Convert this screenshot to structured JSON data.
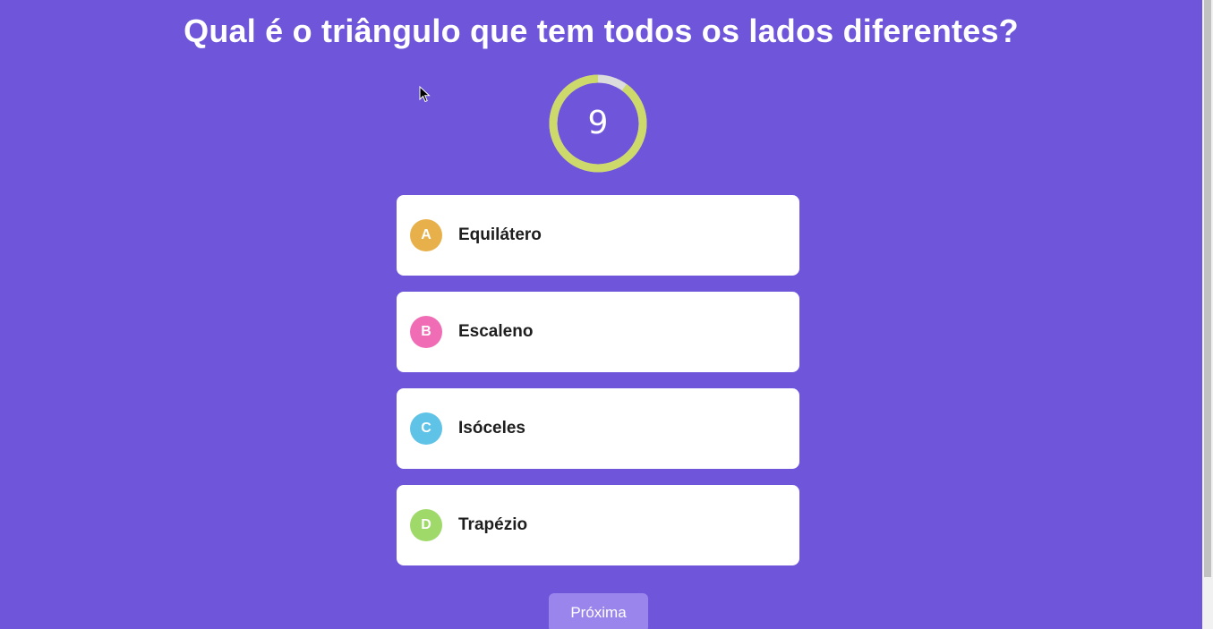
{
  "question": {
    "text": "Qual é o triângulo que tem todos os lados diferentes?"
  },
  "timer": {
    "value": "9",
    "remaining_fraction": 0.9,
    "ring_color": "#cdd96a",
    "track_color": "#dcdcdc"
  },
  "answers": [
    {
      "letter": "A",
      "label": "Equilátero",
      "color": "#e8b04a"
    },
    {
      "letter": "B",
      "label": "Escaleno",
      "color": "#f06db5"
    },
    {
      "letter": "C",
      "label": "Isóceles",
      "color": "#5ec3e6"
    },
    {
      "letter": "D",
      "label": "Trapézio",
      "color": "#9fd96a"
    }
  ],
  "next_button": {
    "label": "Próxima"
  },
  "colors": {
    "background": "#6e55d9",
    "next_button": "#9a85ec"
  }
}
